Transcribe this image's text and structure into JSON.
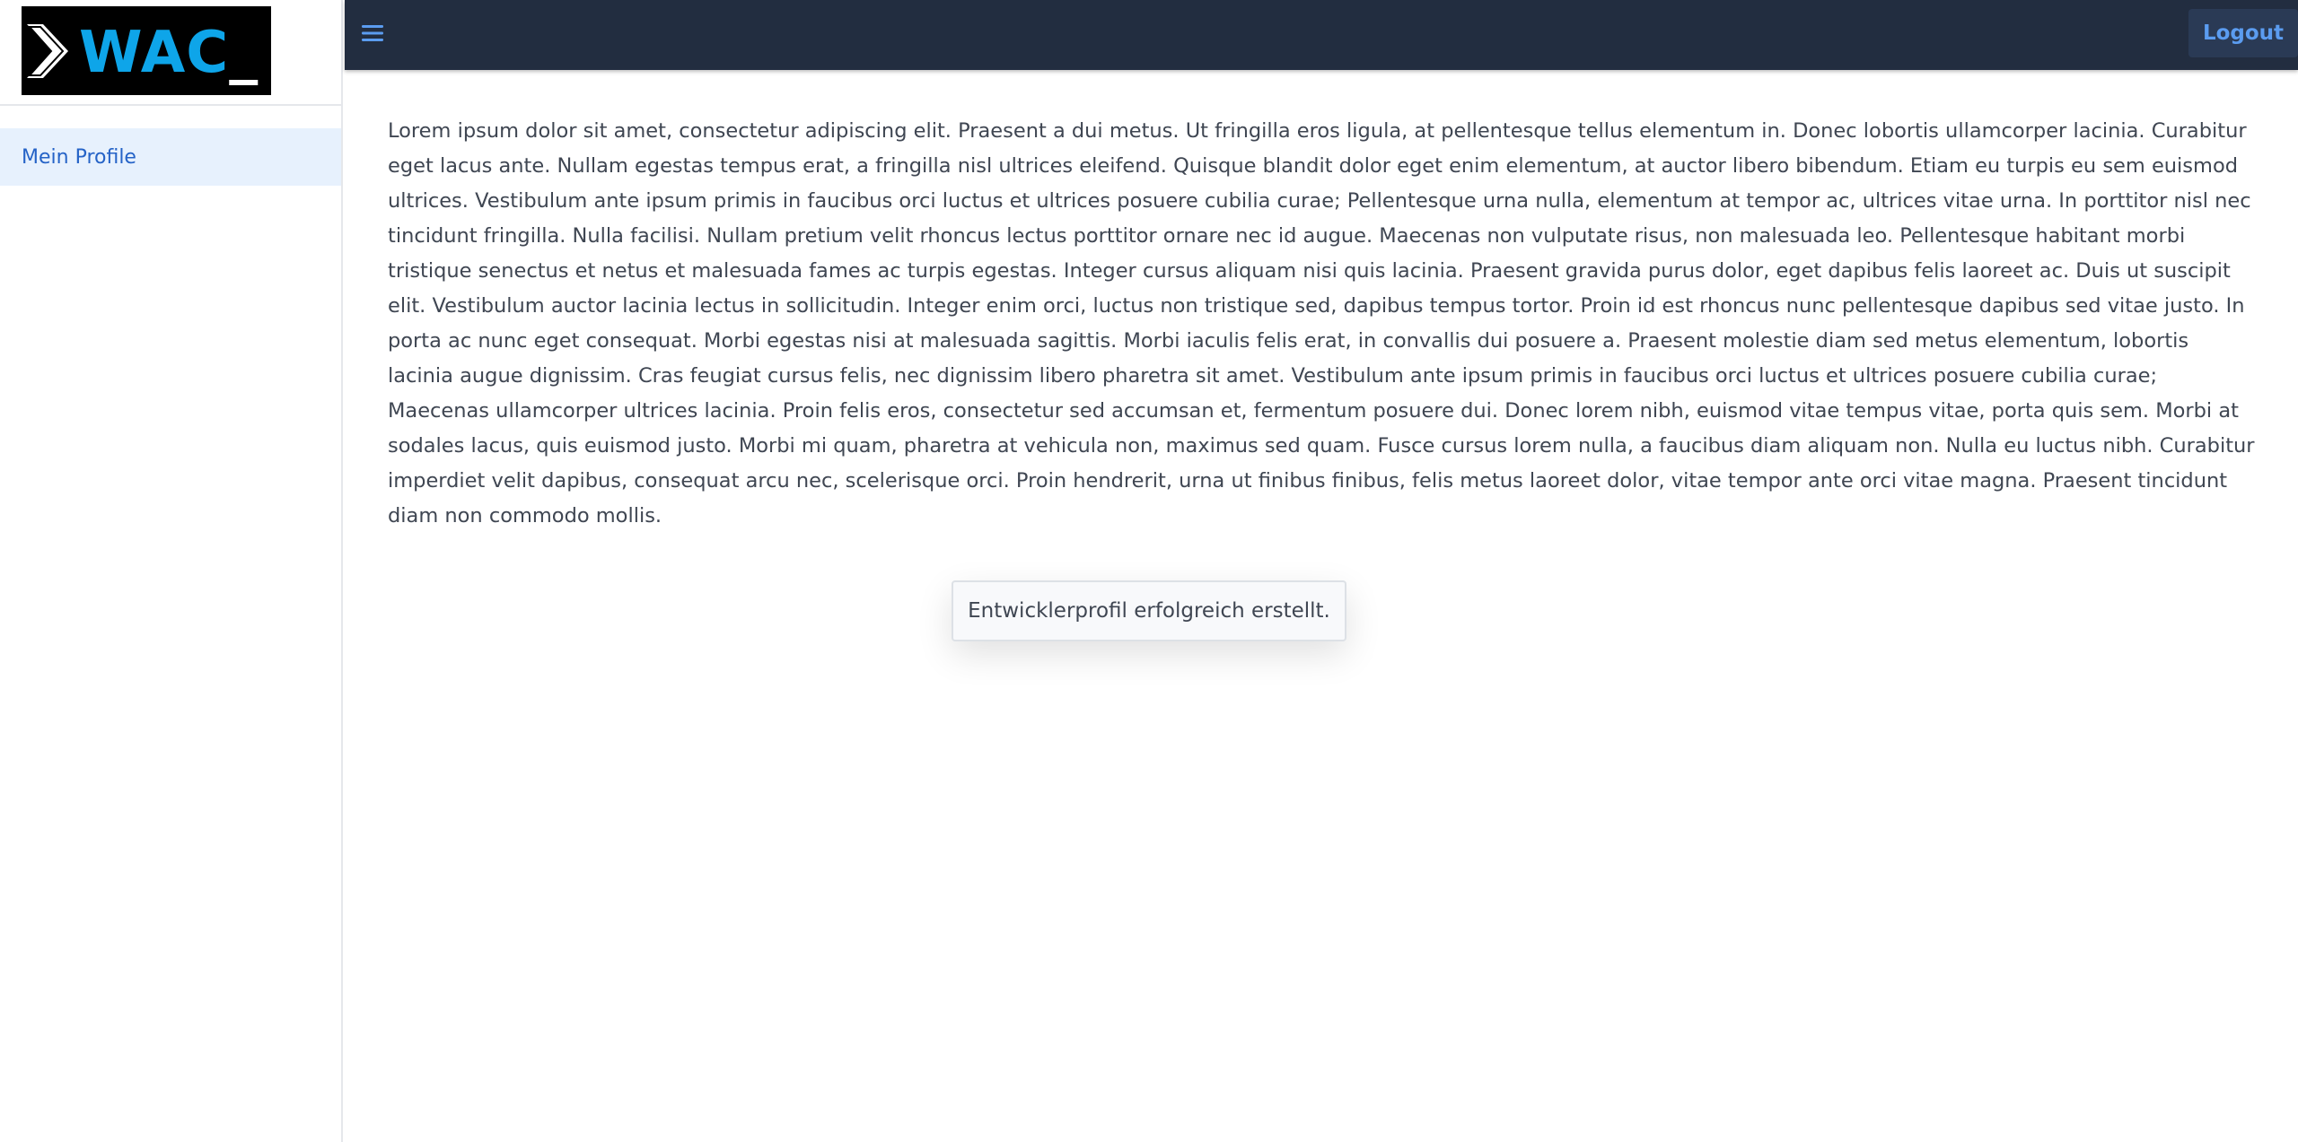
{
  "brand": {
    "logo_text": "WAC",
    "logo_suffix": "_",
    "logo_colors": {
      "background": "#000000",
      "text": "#0ea5e9",
      "chevron": "#ffffff"
    }
  },
  "sidebar": {
    "items": [
      {
        "label": "Mein Profile",
        "active": true
      }
    ]
  },
  "topbar": {
    "menu_icon": "hamburger-menu-icon",
    "logout_label": "Logout"
  },
  "main": {
    "paragraph": "Lorem ipsum dolor sit amet, consectetur adipiscing elit. Praesent a dui metus. Ut fringilla eros ligula, at pellentesque tellus elementum in. Donec lobortis ullamcorper lacinia. Curabitur eget lacus ante. Nullam egestas tempus erat, a fringilla nisl ultrices eleifend. Quisque blandit dolor eget enim elementum, at auctor libero bibendum. Etiam eu turpis eu sem euismod ultrices. Vestibulum ante ipsum primis in faucibus orci luctus et ultrices posuere cubilia curae; Pellentesque urna nulla, elementum at tempor ac, ultrices vitae urna. In porttitor nisl nec tincidunt fringilla. Nulla facilisi. Nullam pretium velit rhoncus lectus porttitor ornare nec id augue. Maecenas non vulputate risus, non malesuada leo. Pellentesque habitant morbi tristique senectus et netus et malesuada fames ac turpis egestas. Integer cursus aliquam nisi quis lacinia. Praesent gravida purus dolor, eget dapibus felis laoreet ac. Duis ut suscipit elit. Vestibulum auctor lacinia lectus in sollicitudin. Integer enim orci, luctus non tristique sed, dapibus tempus tortor. Proin id est rhoncus nunc pellentesque dapibus sed vitae justo. In porta ac nunc eget consequat. Morbi egestas nisi at malesuada sagittis. Morbi iaculis felis erat, in convallis dui posuere a. Praesent molestie diam sed metus elementum, lobortis lacinia augue dignissim. Cras feugiat cursus felis, nec dignissim libero pharetra sit amet. Vestibulum ante ipsum primis in faucibus orci luctus et ultrices posuere cubilia curae; Maecenas ullamcorper ultrices lacinia. Proin felis eros, consectetur sed accumsan et, fermentum posuere dui. Donec lorem nibh, euismod vitae tempus vitae, porta quis sem. Morbi at sodales lacus, quis euismod justo. Morbi mi quam, pharetra at vehicula non, maximus sed quam. Fusce cursus lorem nulla, a faucibus diam aliquam non. Nulla eu luctus nibh. Curabitur imperdiet velit dapibus, consequat arcu nec, scelerisque orci. Proin hendrerit, urna ut finibus finibus, felis metus laoreet dolor, vitae tempor ante orci vitae magna. Praesent tincidunt diam non commodo mollis."
  },
  "toast": {
    "message": "Entwicklerprofil erfolgreich erstellt."
  },
  "colors": {
    "topbar": "#222d40",
    "accent": "#2563c7",
    "active_item_bg": "#e7f1fd"
  }
}
